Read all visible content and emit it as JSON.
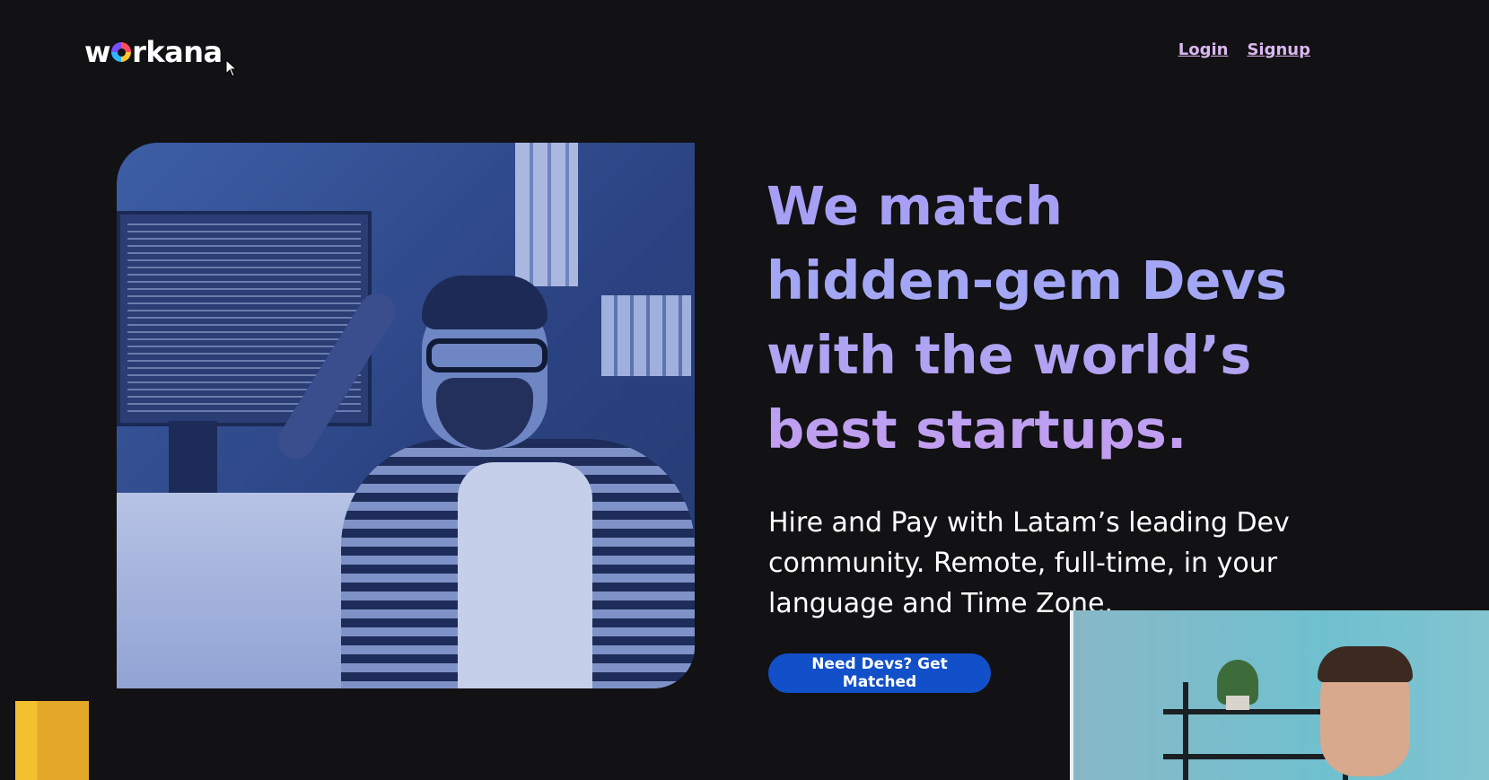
{
  "header": {
    "logo_text_before": "w",
    "logo_text_after": "rkana",
    "nav": {
      "login": "Login",
      "signup": "Signup"
    }
  },
  "hero": {
    "headline_lines": [
      "We match",
      "hidden-gem Devs",
      "with the world’s",
      "best startups."
    ],
    "subheadline": "Hire and Pay with Latam’s leading Dev community. Remote, full-time, in your language and Time Zone.",
    "cta_label": "Need Devs? Get Matched"
  },
  "colors": {
    "background": "#121113",
    "headline_gradient_start": "#a99cf5",
    "headline_gradient_end": "#c69df0",
    "nav_link": "#d9b8f0",
    "cta_background": "#1250c9"
  },
  "icons": {
    "cursor": "mouse-pointer-icon",
    "logo_dot": "workana-o-icon"
  }
}
